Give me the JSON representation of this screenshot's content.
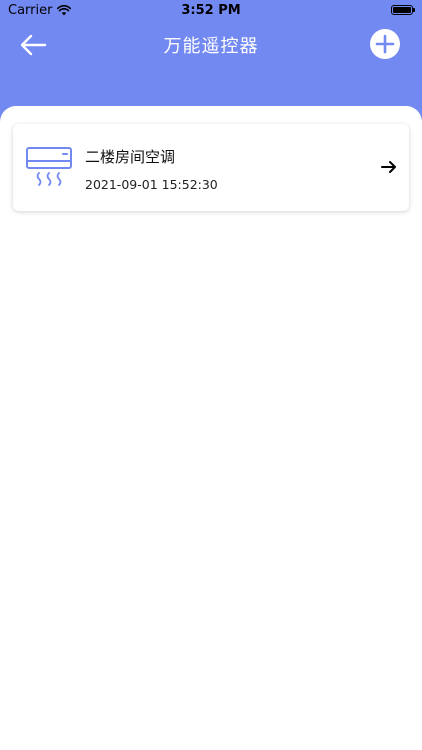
{
  "status_bar": {
    "carrier": "Carrier",
    "time": "3:52 PM"
  },
  "nav": {
    "title": "万能遥控器",
    "back_icon": "arrow-left-icon",
    "add_icon": "plus-circle-icon"
  },
  "devices": [
    {
      "name": "二楼房间空调",
      "time": "2021-09-01 15:52:30",
      "icon": "air-conditioner-icon"
    }
  ],
  "colors": {
    "header": "#7389f2",
    "accent": "#7389f2",
    "background": "#ffffff"
  }
}
